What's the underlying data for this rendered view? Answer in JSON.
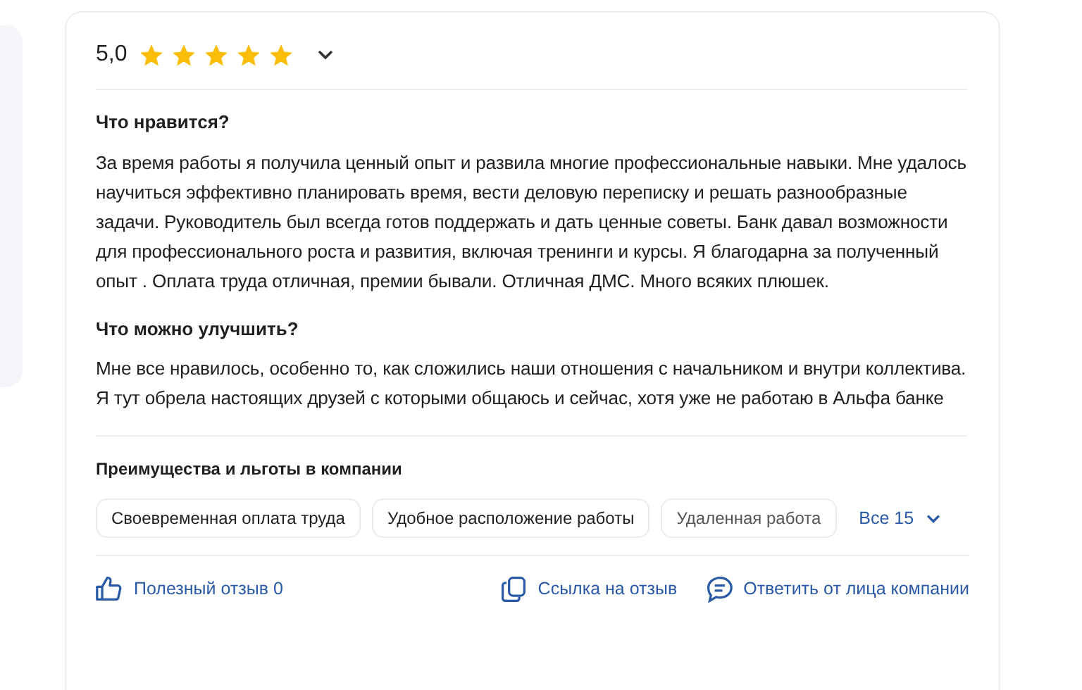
{
  "review": {
    "rating": "5,0",
    "stars": 5,
    "sections": [
      {
        "heading": "Что нравится?",
        "text": "За время работы я получила ценный опыт и развила многие профессиональные навыки. Мне удалось научиться эффективно планировать время, вести деловую переписку и решать разнообразные задачи. Руководитель был всегда готов поддержать и дать ценные советы. Банк давал возможности для профессионального роста и развития, включая тренинги и курсы. Я благодарна за полученный опыт . Оплата труда отличная, премии бывали. Отличная ДМС. Много всяких плюшек."
      },
      {
        "heading": "Что можно улучшить?",
        "text": "Мне все нравилось, особенно то, как сложились наши отношения с начальником и внутри коллектива. Я тут обрела настоящих друзей с которыми общаюсь и сейчас, хотя уже не работаю в Альфа банке"
      }
    ],
    "benefits_title": "Преимущества и льготы в компании",
    "benefits": [
      "Своевременная оплата труда",
      "Удобное расположение работы",
      "Удаленная работа"
    ],
    "show_all": "Все 15",
    "actions": [
      {
        "kind": "like",
        "label": "Полезный отзыв 0"
      },
      {
        "kind": "link",
        "label": "Ссылка на отзыв"
      },
      {
        "kind": "reply",
        "label": "Ответить от лица компании"
      }
    ]
  }
}
